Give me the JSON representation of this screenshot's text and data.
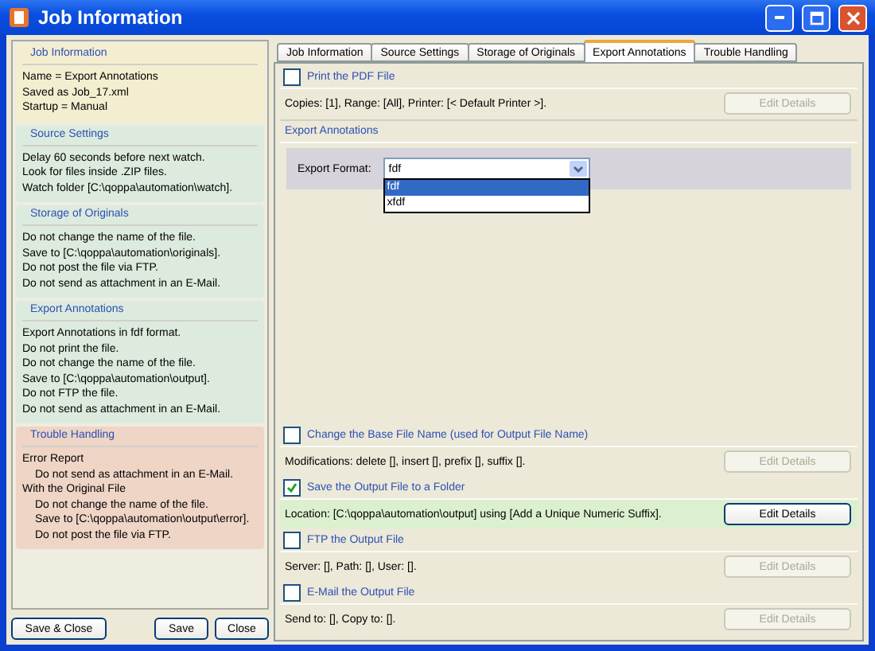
{
  "window": {
    "title": "Job Information"
  },
  "summary": {
    "sections": [
      {
        "title": "Job Information",
        "color": "#f4eed0",
        "lines": [
          {
            "text": "Name = Export Annotations"
          },
          {
            "text": "Saved as Job_17.xml"
          },
          {
            "text": "Startup = Manual"
          }
        ]
      },
      {
        "title": "Source Settings",
        "color": "#dcebde",
        "lines": [
          {
            "text": "Delay 60 seconds before next watch."
          },
          {
            "text": "Look for files inside .ZIP files."
          },
          {
            "text": "Watch folder [C:\\qoppa\\automation\\watch]."
          }
        ]
      },
      {
        "title": "Storage of Originals",
        "color": "#dcebde",
        "lines": [
          {
            "text": "Do not change the name of the file."
          },
          {
            "text": "Save to [C:\\qoppa\\automation\\originals]."
          },
          {
            "text": "Do not post the file via FTP."
          },
          {
            "text": "Do not send as attachment in an E-Mail."
          }
        ]
      },
      {
        "title": "Export Annotations",
        "color": "#dcebde",
        "lines": [
          {
            "text": "Export Annotations in fdf format."
          },
          {
            "text": "Do not print the file."
          },
          {
            "text": "Do not change the name of the file."
          },
          {
            "text": "Save to [C:\\qoppa\\automation\\output]."
          },
          {
            "text": "Do not FTP the file."
          },
          {
            "text": "Do not send as attachment in an E-Mail."
          }
        ]
      },
      {
        "title": "Trouble Handling",
        "color": "#efd5c6",
        "lines": [
          {
            "text": "Error Report",
            "children": [
              {
                "text": "Do not send as attachment in an E-Mail."
              }
            ]
          },
          {
            "text": "With the Original File",
            "children": [
              {
                "text": "Do not change the name of the file."
              },
              {
                "text": "Save to [C:\\qoppa\\automation\\output\\error]."
              },
              {
                "text": "Do not post the file via FTP."
              }
            ]
          }
        ]
      }
    ]
  },
  "footer_buttons": [
    {
      "label": "Save & Close"
    },
    {
      "label": "Save"
    },
    {
      "label": "Close"
    }
  ],
  "tabs": [
    {
      "label": "Job Information",
      "selected": false
    },
    {
      "label": "Source Settings",
      "selected": false
    },
    {
      "label": "Storage of Originals",
      "selected": false
    },
    {
      "label": "Export Annotations",
      "selected": true
    },
    {
      "label": "Trouble Handling",
      "selected": false
    }
  ],
  "panels": [
    {
      "kind": "option",
      "label": "Print the PDF File",
      "checked": false,
      "detail": "Copies: [1], Range: [All], Printer: [< Default Printer >].",
      "button": {
        "label": "Edit Details",
        "disabled": true
      }
    },
    {
      "kind": "format",
      "title": "Export Annotations",
      "field_label": "Export Format:",
      "value": "fdf",
      "expanded": true,
      "options": [
        {
          "label": "fdf",
          "selected": true
        },
        {
          "label": "xfdf",
          "selected": false
        }
      ]
    },
    {
      "kind": "spacer"
    },
    {
      "kind": "option",
      "label": "Change the Base File Name (used for Output File Name)",
      "checked": false,
      "detail": "Modifications: delete [], insert [], prefix [], suffix [].",
      "button": {
        "label": "Edit Details",
        "disabled": true
      }
    },
    {
      "kind": "option",
      "label": "Save the Output File to a Folder",
      "checked": true,
      "detail": "Location: [C:\\qoppa\\automation\\output] using [Add a Unique Numeric Suffix].",
      "button": {
        "label": "Edit Details",
        "disabled": false
      }
    },
    {
      "kind": "option",
      "label": "FTP the Output File",
      "checked": false,
      "detail": "Server: [], Path: [], User: [].",
      "button": {
        "label": "Edit Details",
        "disabled": true
      }
    },
    {
      "kind": "option",
      "label": "E-Mail the Output File",
      "checked": false,
      "detail": "Send to: [], Copy to: [].",
      "button": {
        "label": "Edit Details",
        "disabled": true
      }
    }
  ]
}
